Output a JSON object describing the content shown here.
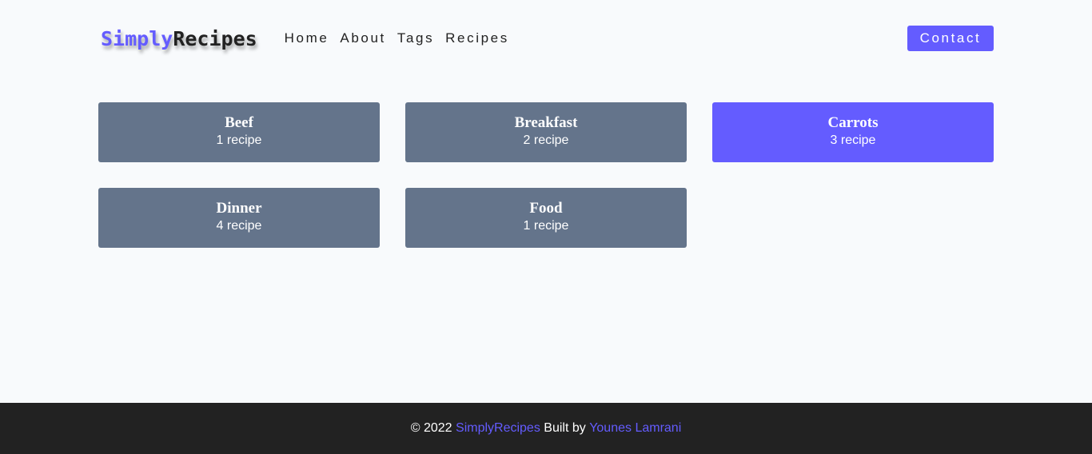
{
  "colors": {
    "accent": "#645cff",
    "card": "#64748b",
    "background": "#f8fafc",
    "footer": "#222222"
  },
  "navbar": {
    "logo_part1": "Simply",
    "logo_part2": "Recipes",
    "links": [
      {
        "label": "Home"
      },
      {
        "label": "About"
      },
      {
        "label": "Tags"
      },
      {
        "label": "Recipes"
      }
    ],
    "contact_label": "Contact"
  },
  "tags": [
    {
      "name": "Beef",
      "count": "1 recipe",
      "active": false
    },
    {
      "name": "Breakfast",
      "count": "2 recipe",
      "active": false
    },
    {
      "name": "Carrots",
      "count": "3 recipe",
      "active": true
    },
    {
      "name": "Dinner",
      "count": "4 recipe",
      "active": false
    },
    {
      "name": "Food",
      "count": "1 recipe",
      "active": false
    }
  ],
  "footer": {
    "copyright": "© 2022",
    "site_name": "SimplyRecipes",
    "built_by": "Built by",
    "author": "Younes Lamrani"
  }
}
